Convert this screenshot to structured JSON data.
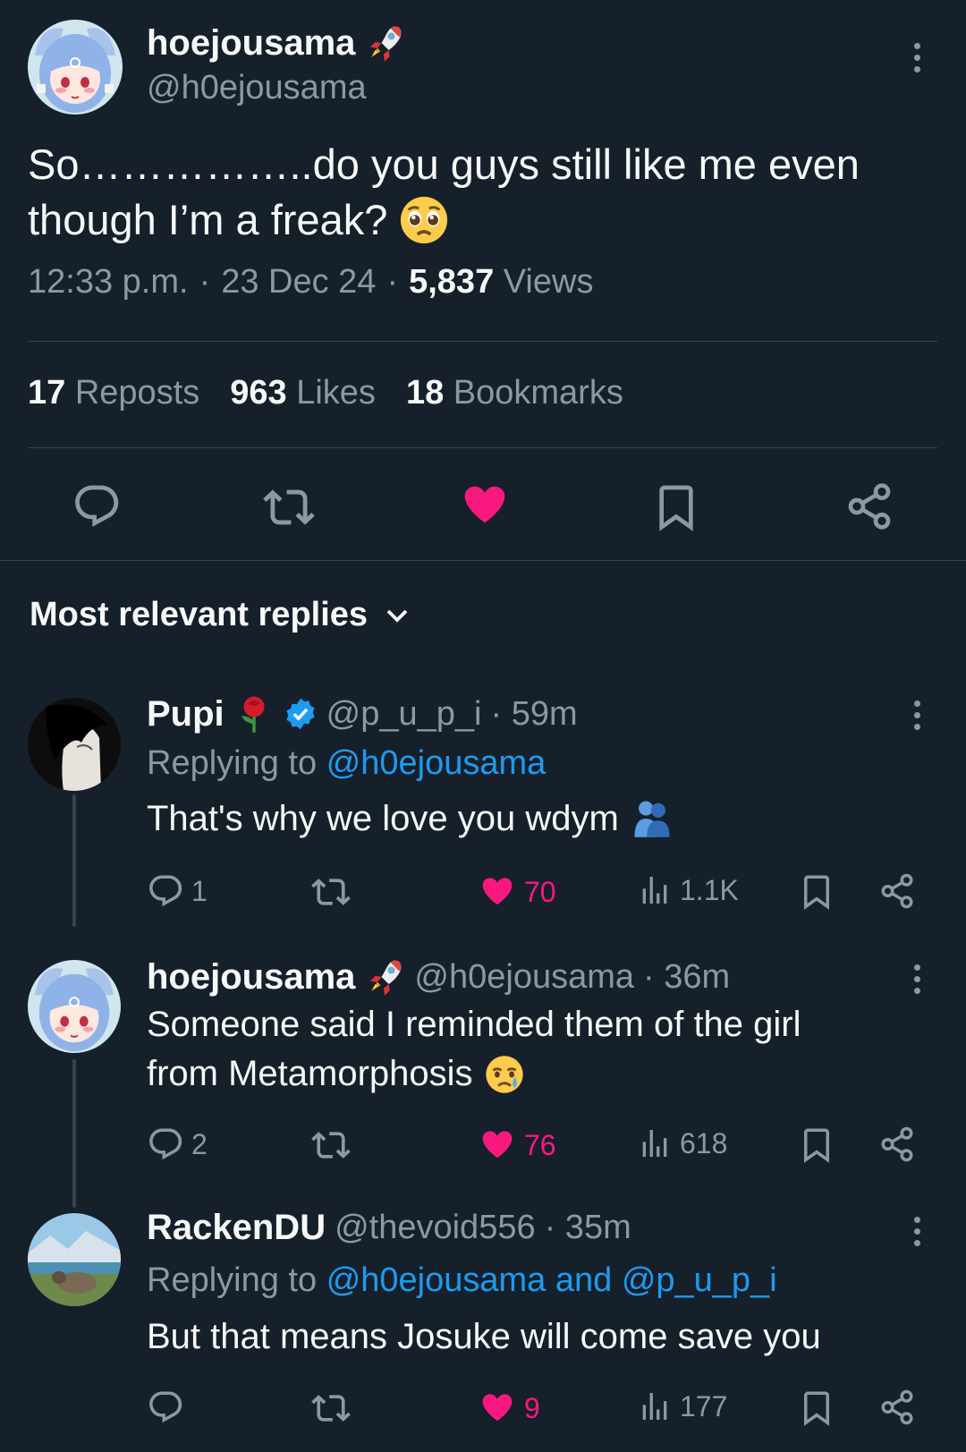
{
  "post": {
    "author_name": "hoejousama",
    "author_handle": "@h0ejousama",
    "text_line1": "So……………..do you guys still like me even",
    "text_line2": "though I’m a freak?",
    "time": "12:33 p.m.",
    "sep": "·",
    "date": "23 Dec 24",
    "views_count": "5,837",
    "views_label": "Views",
    "reposts_count": "17",
    "reposts_label": "Reposts",
    "likes_count": "963",
    "likes_label": "Likes",
    "bookmarks_count": "18",
    "bookmarks_label": "Bookmarks"
  },
  "replies_header": "Most relevant replies",
  "replies": [
    {
      "name": "Pupi",
      "handle": "@p_u_p_i",
      "age": "· 59m",
      "replying_prefix": "Replying to",
      "replying_to": "@h0ejousama",
      "text_line1": "That's why we love you wdym",
      "reply_count": "1",
      "like_count": "70",
      "view_count": "1.1K"
    },
    {
      "name": "hoejousama",
      "handle": "@h0ejousama",
      "age": "· 36m",
      "text_line1": "Someone said I reminded them of the girl",
      "text_line2": "from Metamorphosis",
      "reply_count": "2",
      "like_count": "76",
      "view_count": "618"
    },
    {
      "name": "RackenDU",
      "handle": "@thevoid556",
      "age": "· 35m",
      "replying_prefix": "Replying to",
      "replying_to": "@h0ejousama and @p_u_p_i",
      "text_line1": "But that means Josuke will come save you",
      "reply_count": "",
      "like_count": "9",
      "view_count": "177"
    }
  ],
  "colors": {
    "background": "#15202b",
    "text": "#f7f9f9",
    "muted": "#8b98a5",
    "link": "#1d9bf0",
    "like": "#f91880",
    "divider": "#38444d"
  },
  "icons": [
    "rocket-icon",
    "more-icon",
    "pleading-face-emoji",
    "reply-icon",
    "repost-icon",
    "heart-icon",
    "bookmark-icon",
    "share-icon",
    "chevron-down-icon",
    "rose-emoji",
    "verified-badge-icon",
    "hug-emoji",
    "crying-face-emoji",
    "views-icon"
  ]
}
